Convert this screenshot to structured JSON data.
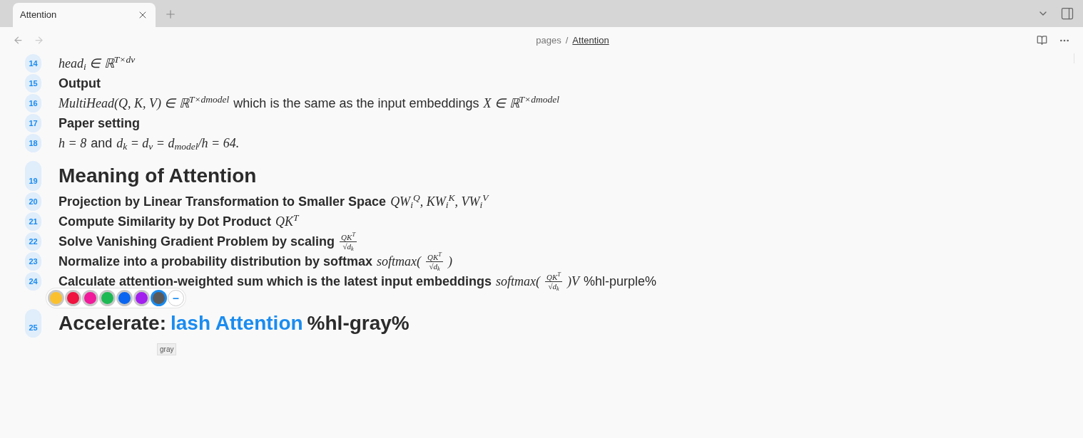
{
  "tabs": [
    {
      "label": "Attention",
      "selected": true
    }
  ],
  "breadcrumb": {
    "parent": "pages",
    "separator": "/",
    "current": "Attention"
  },
  "lines": [
    {
      "number": "14",
      "kind": "para",
      "segments": [
        {
          "kind": "math",
          "text": "head$_{i}$ ∈ ℝ$^{T×dv}$"
        }
      ]
    },
    {
      "number": "15",
      "kind": "label",
      "segments": [
        {
          "kind": "bold",
          "text": "Output"
        }
      ]
    },
    {
      "number": "16",
      "kind": "para",
      "segments": [
        {
          "kind": "math",
          "text": "MultiHead(Q, K, V) ∈ ℝ$^{T×dmodel}$"
        },
        {
          "kind": "text",
          "text": "which is the same as the input embeddings"
        },
        {
          "kind": "math",
          "text": "X ∈ ℝ$^{T×dmodel}$"
        }
      ]
    },
    {
      "number": "17",
      "kind": "label",
      "segments": [
        {
          "kind": "bold",
          "text": "Paper setting"
        }
      ]
    },
    {
      "number": "18",
      "kind": "para",
      "segments": [
        {
          "kind": "math",
          "text": "h = 8"
        },
        {
          "kind": "text",
          "text": "and"
        },
        {
          "kind": "math",
          "text": "d$_{k}$ = d$_{v}$ = d$_{model}$/h = 64."
        }
      ]
    },
    {
      "number": "19",
      "kind": "heading",
      "segments": [
        {
          "kind": "bold",
          "text": "Meaning of Attention"
        }
      ]
    },
    {
      "number": "20",
      "kind": "label",
      "segments": [
        {
          "kind": "bold",
          "text": "Projection by Linear Transformation to Smaller Space"
        },
        {
          "kind": "math",
          "text": "QW$_{i}$$^{Q}$, KW$_{i}$$^{K}$, VW$_{i}$$^{V}$"
        }
      ]
    },
    {
      "number": "21",
      "kind": "label",
      "segments": [
        {
          "kind": "bold",
          "text": "Compute Similarity by Dot Product"
        },
        {
          "kind": "math",
          "text": "QK$^{T}$"
        }
      ]
    },
    {
      "number": "22",
      "kind": "label",
      "segments": [
        {
          "kind": "bold",
          "text": "Solve Vanishing Gradient Problem by scaling"
        },
        {
          "kind": "frac",
          "num": "QK$^{T}$",
          "den": "√d$_{k}$"
        }
      ]
    },
    {
      "number": "23",
      "kind": "label",
      "segments": [
        {
          "kind": "bold",
          "text": "Normalize into a probability distribution by softmax"
        },
        {
          "kind": "math",
          "text": "softmax("
        },
        {
          "kind": "frac",
          "num": "QK$^{T}$",
          "den": "√d$_{k}$"
        },
        {
          "kind": "math",
          "text": ")"
        }
      ]
    },
    {
      "number": "24",
      "kind": "label",
      "segments": [
        {
          "kind": "bold",
          "text": "Calculate attention-weighted sum which is the latest input embeddings"
        },
        {
          "kind": "math",
          "text": "softmax("
        },
        {
          "kind": "frac",
          "num": "QK$^{T}$",
          "den": "√d$_{k}$"
        },
        {
          "kind": "math",
          "text": ")V"
        },
        {
          "kind": "text",
          "text": "%hl-purple%"
        }
      ]
    },
    {
      "number": "25",
      "kind": "heading",
      "segments": [
        {
          "kind": "bold",
          "text": "Accelerate:"
        },
        {
          "kind": "link",
          "text": "lash Attention"
        },
        {
          "kind": "bold",
          "text": "%hl-gray%"
        }
      ]
    }
  ],
  "palette": {
    "colors": [
      {
        "color": "#fbc02d",
        "selected": false
      },
      {
        "color": "#f0123f",
        "selected": false
      },
      {
        "color": "#f01a9a",
        "selected": false
      },
      {
        "color": "#1db954",
        "selected": false
      },
      {
        "color": "#0a66f0",
        "selected": false
      },
      {
        "color": "#a21ff0",
        "selected": false
      },
      {
        "color": "#5a5a5a",
        "selected": true
      }
    ],
    "remove": "–",
    "tooltip": "gray"
  }
}
